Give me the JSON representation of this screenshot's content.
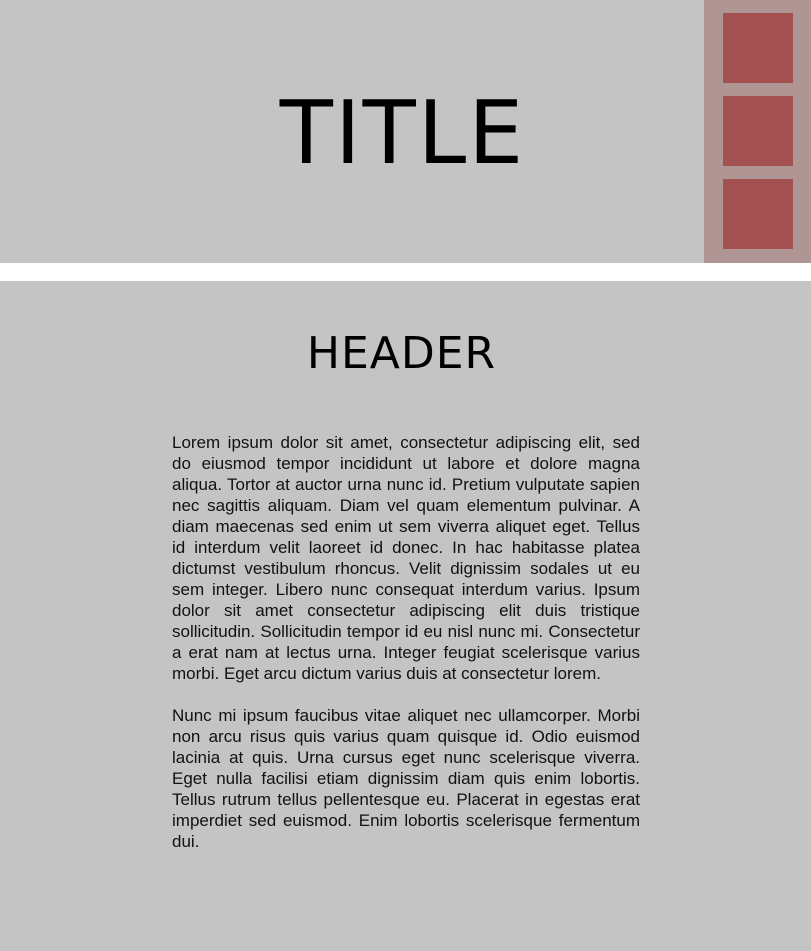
{
  "banner": {
    "title": "TITLE"
  },
  "sidebar": {
    "items": [
      {
        "name": "box-1"
      },
      {
        "name": "box-2"
      },
      {
        "name": "box-3"
      }
    ]
  },
  "content": {
    "header": "HEADER",
    "paragraphs": [
      "Lorem ipsum dolor sit amet, consectetur adipiscing elit, sed do eiusmod tempor incididunt ut labore et dolore magna aliqua. Tortor at auctor urna nunc id. Pretium vulputate sapien nec sagittis aliquam. Diam vel quam elementum pulvinar. A diam maecenas sed enim ut sem viverra aliquet eget. Tellus id interdum velit laoreet id donec. In hac habitasse platea dictumst vestibulum rhoncus. Velit dignissim sodales ut eu sem integer. Libero nunc consequat interdum varius. Ipsum dolor sit amet consectetur adipiscing elit duis tristique sollicitudin. Sollicitudin tempor id eu nisl nunc mi. Consectetur a erat nam at lectus urna. Integer feugiat scelerisque varius morbi. Eget arcu dictum varius duis at consectetur lorem.",
      "Nunc mi ipsum faucibus vitae aliquet nec ullamcorper. Morbi non arcu risus quis varius quam quisque id. Odio euismod lacinia at quis. Urna cursus eget nunc scelerisque viverra. Eget nulla facilisi etiam dignissim diam quis enim lobortis. Tellus rutrum tellus pellentesque eu. Placerat in egestas erat imperdiet sed euismod. Enim lobortis scelerisque fermentum dui."
    ]
  },
  "colors": {
    "panel_background": "#c4c4c4",
    "sidebar_background": "#b09595",
    "sidebar_box": "#a45151",
    "divider": "#ffffff"
  }
}
